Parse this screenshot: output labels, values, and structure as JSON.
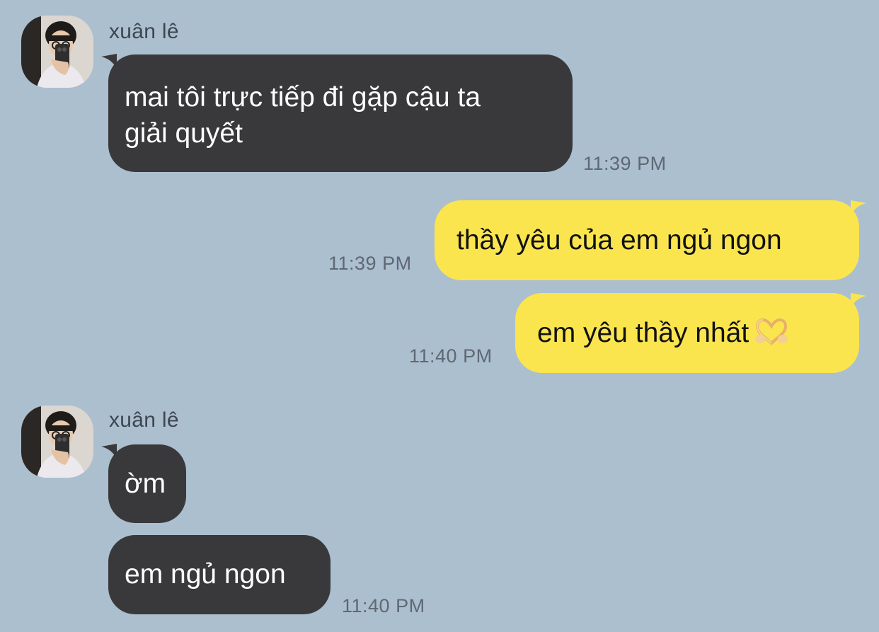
{
  "chat": {
    "group1": {
      "sender": "xuân lê",
      "messages": [
        {
          "text_line1": "mai tôi trực tiếp đi gặp cậu ta",
          "text_line2": "giải quyết",
          "time": "11:39 PM"
        }
      ]
    },
    "outgoing": [
      {
        "text": "thầy yêu của em ngủ ngon",
        "time": "11:39 PM"
      },
      {
        "text": "em yêu thầy nhất",
        "emoji": "heart-hands-emoji",
        "time": "11:40 PM"
      }
    ],
    "group2": {
      "sender": "xuân lê",
      "messages": [
        {
          "text": "ờm"
        },
        {
          "text": "em ngủ ngon",
          "time": "11:40 PM"
        }
      ]
    }
  },
  "colors": {
    "background": "#abbfcf",
    "incoming_bubble": "#39393b",
    "outgoing_bubble": "#fae54f"
  }
}
